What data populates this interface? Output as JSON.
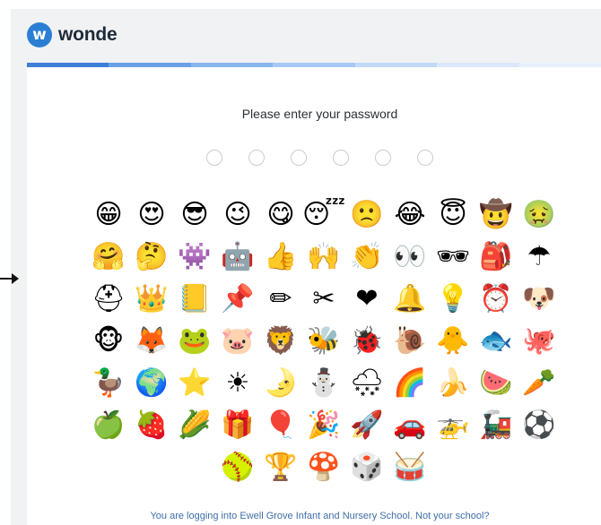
{
  "brand": {
    "name": "wonde",
    "badge_letter": "w",
    "color": "#2a7fd4"
  },
  "progress_colors": [
    "#3d7fd6",
    "#6aa1e6",
    "#8ab6ee",
    "#a7c8f3",
    "#c2d9f7",
    "#dbe8fa",
    "#e9f1fc"
  ],
  "heading": "Please enter your password",
  "password_slots": 6,
  "emoji_rows": [
    [
      "😁",
      "😍",
      "😎",
      "😉",
      "😋",
      "😴",
      "🙁",
      "😂",
      "😇",
      "🤠",
      "🤢"
    ],
    [
      "🤗",
      "🤔",
      "👾",
      "🤖",
      "👍",
      "🙌",
      "👏",
      "👀",
      "🕶",
      "🎒",
      "☂"
    ],
    [
      "⛑",
      "👑",
      "📒",
      "📌",
      "✏",
      "✂",
      "❤",
      "🔔",
      "💡",
      "⏰",
      "🐶"
    ],
    [
      "🐵",
      "🦊",
      "🐸",
      "🐷",
      "🦁",
      "🐝",
      "🐞",
      "🐌",
      "🐥",
      "🐟",
      "🐙"
    ],
    [
      "🦆",
      "🌍",
      "⭐",
      "☀",
      "🌛",
      "⛄",
      "🌨",
      "🌈",
      "🍌",
      "🍉",
      "🥕"
    ],
    [
      "🍏",
      "🍓",
      "🌽",
      "🎁",
      "🎈",
      "🎉",
      "🚀",
      "🚗",
      "🚁",
      "🚂",
      "⚽"
    ],
    [
      "🥎",
      "🏆",
      "🍄",
      "🎲",
      "🥁"
    ]
  ],
  "footer_text": "You are logging into Ewell Grove Infant and Nursery School. Not your school?"
}
